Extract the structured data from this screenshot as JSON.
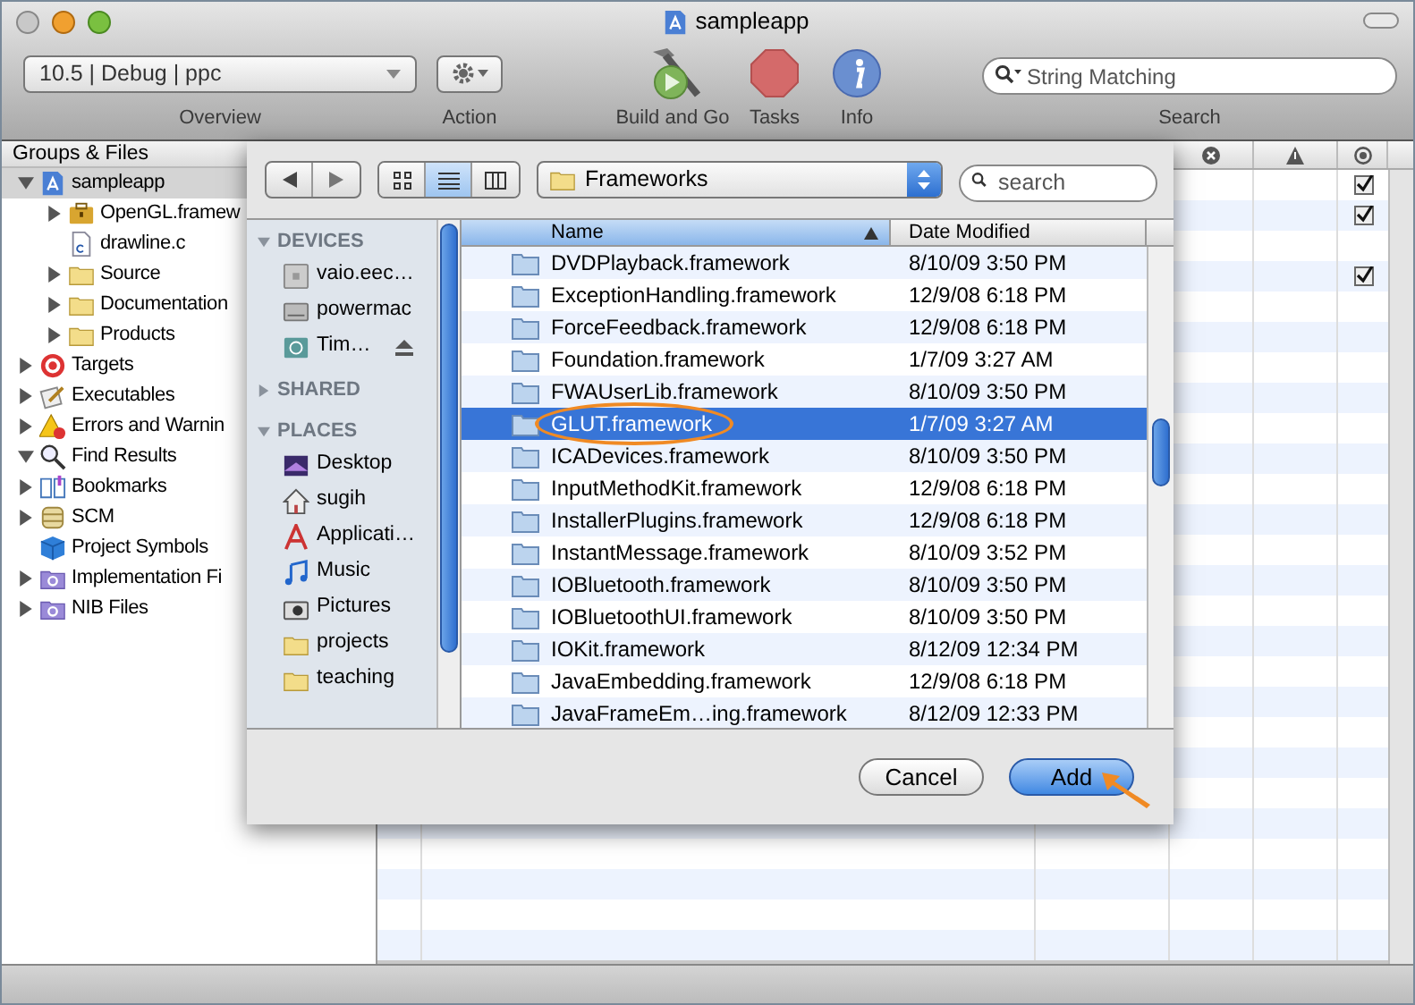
{
  "window": {
    "title": "sampleapp"
  },
  "toolbar": {
    "items": [
      {
        "kind": "popup",
        "value": "10.5 | Debug | ppc",
        "label": "Overview"
      },
      {
        "kind": "action",
        "label": "Action"
      },
      {
        "kind": "build",
        "label": "Build and Go"
      },
      {
        "kind": "tasks",
        "label": "Tasks"
      },
      {
        "kind": "info",
        "label": "Info"
      },
      {
        "kind": "search",
        "placeholder": "String Matching",
        "label": "Search"
      }
    ]
  },
  "sidebar": {
    "title": "Groups & Files",
    "items": [
      {
        "label": "sampleapp",
        "kind": "project",
        "expanded": true,
        "selected": true,
        "children": [
          {
            "label": "OpenGL.framew",
            "kind": "framework",
            "expanded": false,
            "selected": false
          },
          {
            "label": "drawline.c",
            "kind": "c-file",
            "selected": false
          },
          {
            "label": "Source",
            "kind": "folder",
            "expanded": false,
            "selected": false
          },
          {
            "label": "Documentation",
            "kind": "folder",
            "expanded": false,
            "selected": false
          },
          {
            "label": "Products",
            "kind": "folder",
            "expanded": false,
            "selected": false
          }
        ]
      },
      {
        "label": "Targets",
        "kind": "target",
        "expanded": false,
        "selected": false
      },
      {
        "label": "Executables",
        "kind": "executable",
        "expanded": false,
        "selected": false
      },
      {
        "label": "Errors and Warnin",
        "kind": "warning",
        "expanded": false,
        "selected": false
      },
      {
        "label": "Find Results",
        "kind": "search",
        "expanded": true,
        "selected": false
      },
      {
        "label": "Bookmarks",
        "kind": "book",
        "expanded": false,
        "selected": false
      },
      {
        "label": "SCM",
        "kind": "scm",
        "expanded": false,
        "selected": false
      },
      {
        "label": "Project Symbols",
        "kind": "cube",
        "selected": false
      },
      {
        "label": "Implementation Fi",
        "kind": "smart-group",
        "expanded": false,
        "selected": false
      },
      {
        "label": "NIB Files",
        "kind": "smart-group",
        "expanded": false,
        "selected": false
      }
    ]
  },
  "detail_table": {
    "columns": [
      {
        "kind": "errors"
      },
      {
        "kind": "warnings"
      },
      {
        "kind": "build"
      }
    ],
    "rows": [
      {
        "checked": true
      },
      {
        "checked": true
      },
      {
        "checked": false
      },
      {
        "checked": true
      },
      {
        "checked": false
      },
      {
        "checked": false
      },
      {
        "checked": false
      },
      {
        "checked": false
      },
      {
        "checked": false
      },
      {
        "checked": false
      },
      {
        "checked": false
      },
      {
        "checked": false
      },
      {
        "checked": false
      },
      {
        "checked": false
      },
      {
        "checked": false
      },
      {
        "checked": false
      },
      {
        "checked": false
      },
      {
        "checked": false
      },
      {
        "checked": false
      },
      {
        "checked": false
      },
      {
        "checked": false
      },
      {
        "checked": false
      },
      {
        "checked": false
      },
      {
        "checked": false
      },
      {
        "checked": false
      },
      {
        "checked": false
      }
    ]
  },
  "dialog": {
    "view_modes": [
      {
        "kind": "icons",
        "selected": false
      },
      {
        "kind": "list",
        "selected": true
      },
      {
        "kind": "columns",
        "selected": false
      }
    ],
    "location": "Frameworks",
    "search": {
      "placeholder": "search"
    },
    "sidebar": [
      {
        "title": "DEVICES",
        "expanded": true,
        "items": [
          {
            "label": "vaio.eec…",
            "kind": "network",
            "selected": false
          },
          {
            "label": "powermac",
            "kind": "disk",
            "selected": false
          },
          {
            "label": "Tim…",
            "kind": "time-machine",
            "selected": false,
            "ejectable": true
          }
        ]
      },
      {
        "title": "SHARED",
        "expanded": false
      },
      {
        "title": "PLACES",
        "expanded": true,
        "items": [
          {
            "label": "Desktop",
            "kind": "desktop",
            "selected": false
          },
          {
            "label": "sugih",
            "kind": "home",
            "selected": false
          },
          {
            "label": "Applicati…",
            "kind": "applications",
            "selected": false
          },
          {
            "label": "Music",
            "kind": "music",
            "selected": false
          },
          {
            "label": "Pictures",
            "kind": "camera",
            "selected": false
          },
          {
            "label": "projects",
            "kind": "folder",
            "selected": false
          },
          {
            "label": "teaching",
            "kind": "folder",
            "selected": false
          }
        ]
      }
    ],
    "columns": [
      {
        "label": "Name",
        "selected": true
      },
      {
        "label": "Date Modified",
        "selected": false
      }
    ],
    "files": [
      {
        "name": "DVDPlayback.framework",
        "date": "8/10/09 3:50 PM",
        "selected": false,
        "circled": false
      },
      {
        "name": "ExceptionHandling.framework",
        "date": "12/9/08 6:18 PM",
        "selected": false,
        "circled": false
      },
      {
        "name": "ForceFeedback.framework",
        "date": "12/9/08 6:18 PM",
        "selected": false,
        "circled": false
      },
      {
        "name": "Foundation.framework",
        "date": "1/7/09 3:27 AM",
        "selected": false,
        "circled": false
      },
      {
        "name": "FWAUserLib.framework",
        "date": "8/10/09 3:50 PM",
        "selected": false,
        "circled": false
      },
      {
        "name": "GLUT.framework",
        "date": "1/7/09 3:27 AM",
        "selected": true,
        "circled": true
      },
      {
        "name": "ICADevices.framework",
        "date": "8/10/09 3:50 PM",
        "selected": false,
        "circled": false
      },
      {
        "name": "InputMethodKit.framework",
        "date": "12/9/08 6:18 PM",
        "selected": false,
        "circled": false
      },
      {
        "name": "InstallerPlugins.framework",
        "date": "12/9/08 6:18 PM",
        "selected": false,
        "circled": false
      },
      {
        "name": "InstantMessage.framework",
        "date": "8/10/09 3:52 PM",
        "selected": false,
        "circled": false
      },
      {
        "name": "IOBluetooth.framework",
        "date": "8/10/09 3:50 PM",
        "selected": false,
        "circled": false
      },
      {
        "name": "IOBluetoothUI.framework",
        "date": "8/10/09 3:50 PM",
        "selected": false,
        "circled": false
      },
      {
        "name": "IOKit.framework",
        "date": "8/12/09 12:34 PM",
        "selected": false,
        "circled": false
      },
      {
        "name": "JavaEmbedding.framework",
        "date": "12/9/08 6:18 PM",
        "selected": false,
        "circled": false
      },
      {
        "name": "JavaFrameEm…ing.framework",
        "date": "8/12/09 12:33 PM",
        "selected": false,
        "circled": false
      }
    ],
    "buttons": [
      {
        "label": "Cancel",
        "default": false,
        "pointed": false
      },
      {
        "label": "Add",
        "default": true,
        "pointed": true
      }
    ]
  }
}
